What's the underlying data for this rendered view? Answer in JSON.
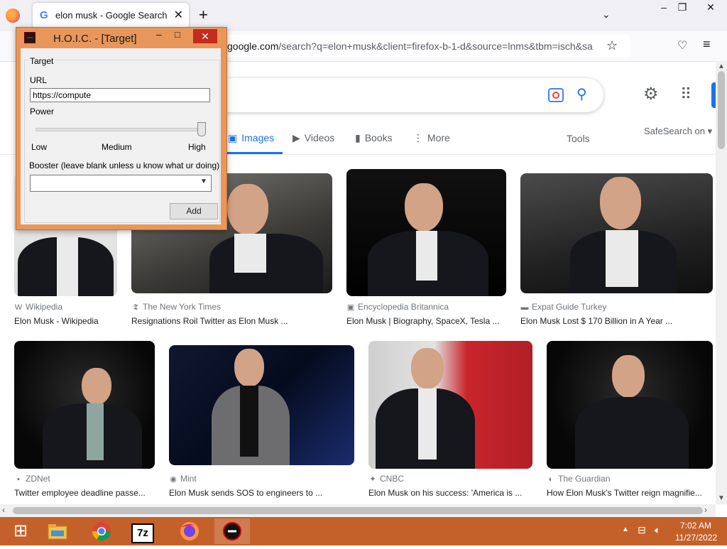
{
  "browser": {
    "tab_title": "elon musk - Google Search",
    "tab_close": "✕",
    "new_tab": "+",
    "url_host": "google.com",
    "url_path": "/search?q=elon+musk&client=firefox-b-1-d&source=lnms&tbm=isch&sa",
    "window_min": "–",
    "window_max": "❐",
    "window_close": "✕"
  },
  "google": {
    "nav_tabs": [
      {
        "icon": "▣",
        "label": "Images"
      },
      {
        "icon": "▶",
        "label": "Videos"
      },
      {
        "icon": "▮",
        "label": "Books"
      },
      {
        "icon": "⋮",
        "label": "More"
      }
    ],
    "tools": "Tools",
    "safesearch": "SafeSearch on ▾",
    "results": [
      {
        "source": "Wikipedia",
        "source_icon": "W",
        "caption": "Elon Musk - Wikipedia"
      },
      {
        "source": "The New York Times",
        "source_icon": "𝕿",
        "caption": "Resignations Roil Twitter as Elon Musk ..."
      },
      {
        "source": "Encyclopedia Britannica",
        "source_icon": "▣",
        "caption": "Elon Musk | Biography, SpaceX, Tesla ..."
      },
      {
        "source": "Expat Guide Turkey",
        "source_icon": "▬",
        "caption": "Elon Musk Lost $ 170 Billion in A Year ..."
      },
      {
        "source": "ZDNet",
        "source_icon": "▪",
        "caption": "Twitter employee deadline passe..."
      },
      {
        "source": "Mint",
        "source_icon": "◉",
        "caption": "Elon Musk sends SOS to engineers to ..."
      },
      {
        "source": "CNBC",
        "source_icon": "✦",
        "caption": "Elon Musk on his success: 'America is ..."
      },
      {
        "source": "The Guardian",
        "source_icon": "◐",
        "caption": "How Elon Musk's Twitter reign magnifie..."
      }
    ]
  },
  "hoic": {
    "title": "H.O.I.C. - [Target]",
    "min": "–",
    "max": "□",
    "close": "✕",
    "group_label": "Target",
    "url_label": "URL",
    "url_value": "https://compute",
    "power_label": "Power",
    "power_level": 1.0,
    "power_low": "Low",
    "power_medium": "Medium",
    "power_high": "High",
    "booster_label": "Booster (leave blank unless u know what ur doing)",
    "booster_value": "",
    "add_button": "Add"
  },
  "taskbar": {
    "time": "7:02 AM",
    "date": "11/27/2022",
    "seven_zip": "7z"
  },
  "colors": {
    "accent_blue": "#1a73e8",
    "hoic_frame": "#e8965a",
    "taskbar": "#c4612a"
  }
}
